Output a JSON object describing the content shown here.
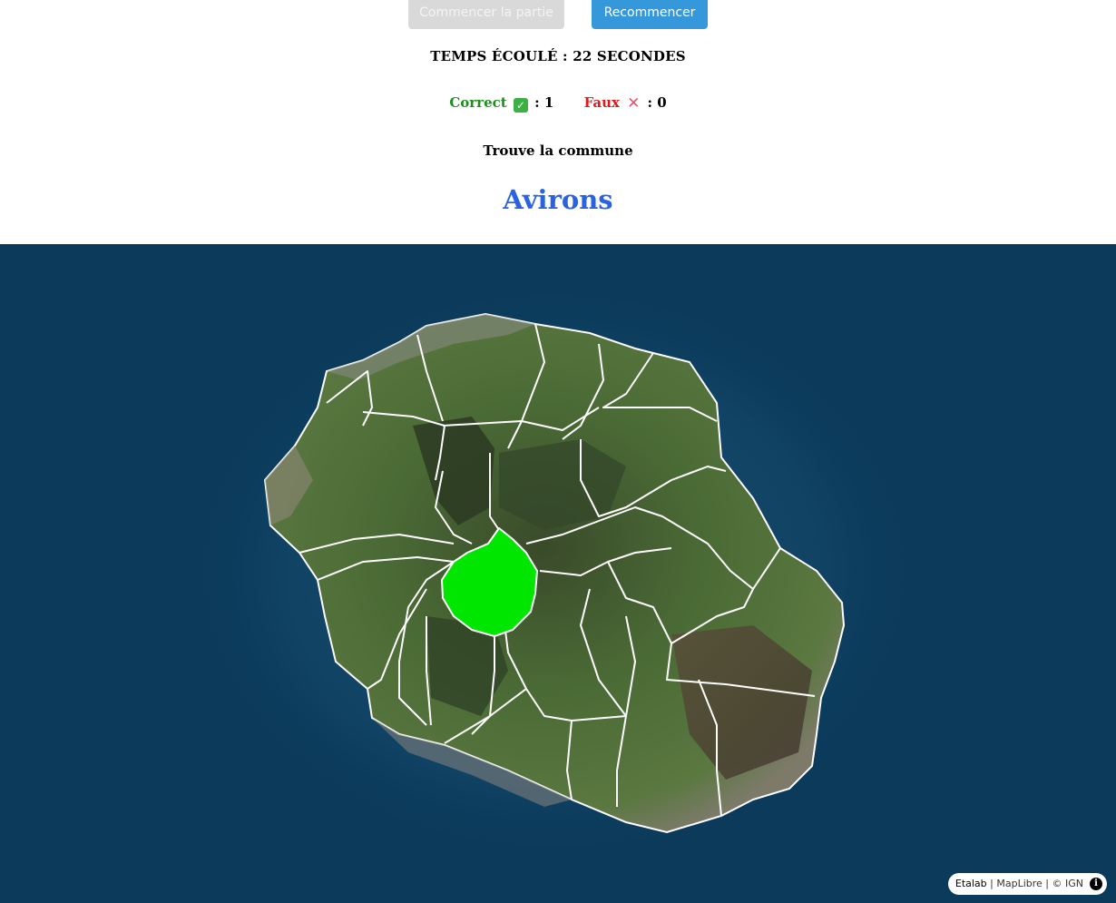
{
  "controls": {
    "start_label": "Commencer la partie",
    "restart_label": "Recommencer"
  },
  "timer": {
    "text": "TEMPS ÉCOULÉ : 22 SECONDES"
  },
  "score": {
    "correct_label": "Correct",
    "correct_icon": "✅",
    "correct_value": ": 1",
    "wrong_label": "Faux",
    "wrong_icon": "❌",
    "wrong_value": ": 0"
  },
  "prompt": {
    "instruction": "Trouve la commune",
    "target_name": "Avirons"
  },
  "map": {
    "highlight_color": "#00e600",
    "border_color": "#ffffff",
    "ocean_color": "#0b3a5a"
  },
  "attribution": {
    "etalab": "Etalab",
    "rest": " | MapLibre | © IGN",
    "info_icon": "info-icon"
  }
}
